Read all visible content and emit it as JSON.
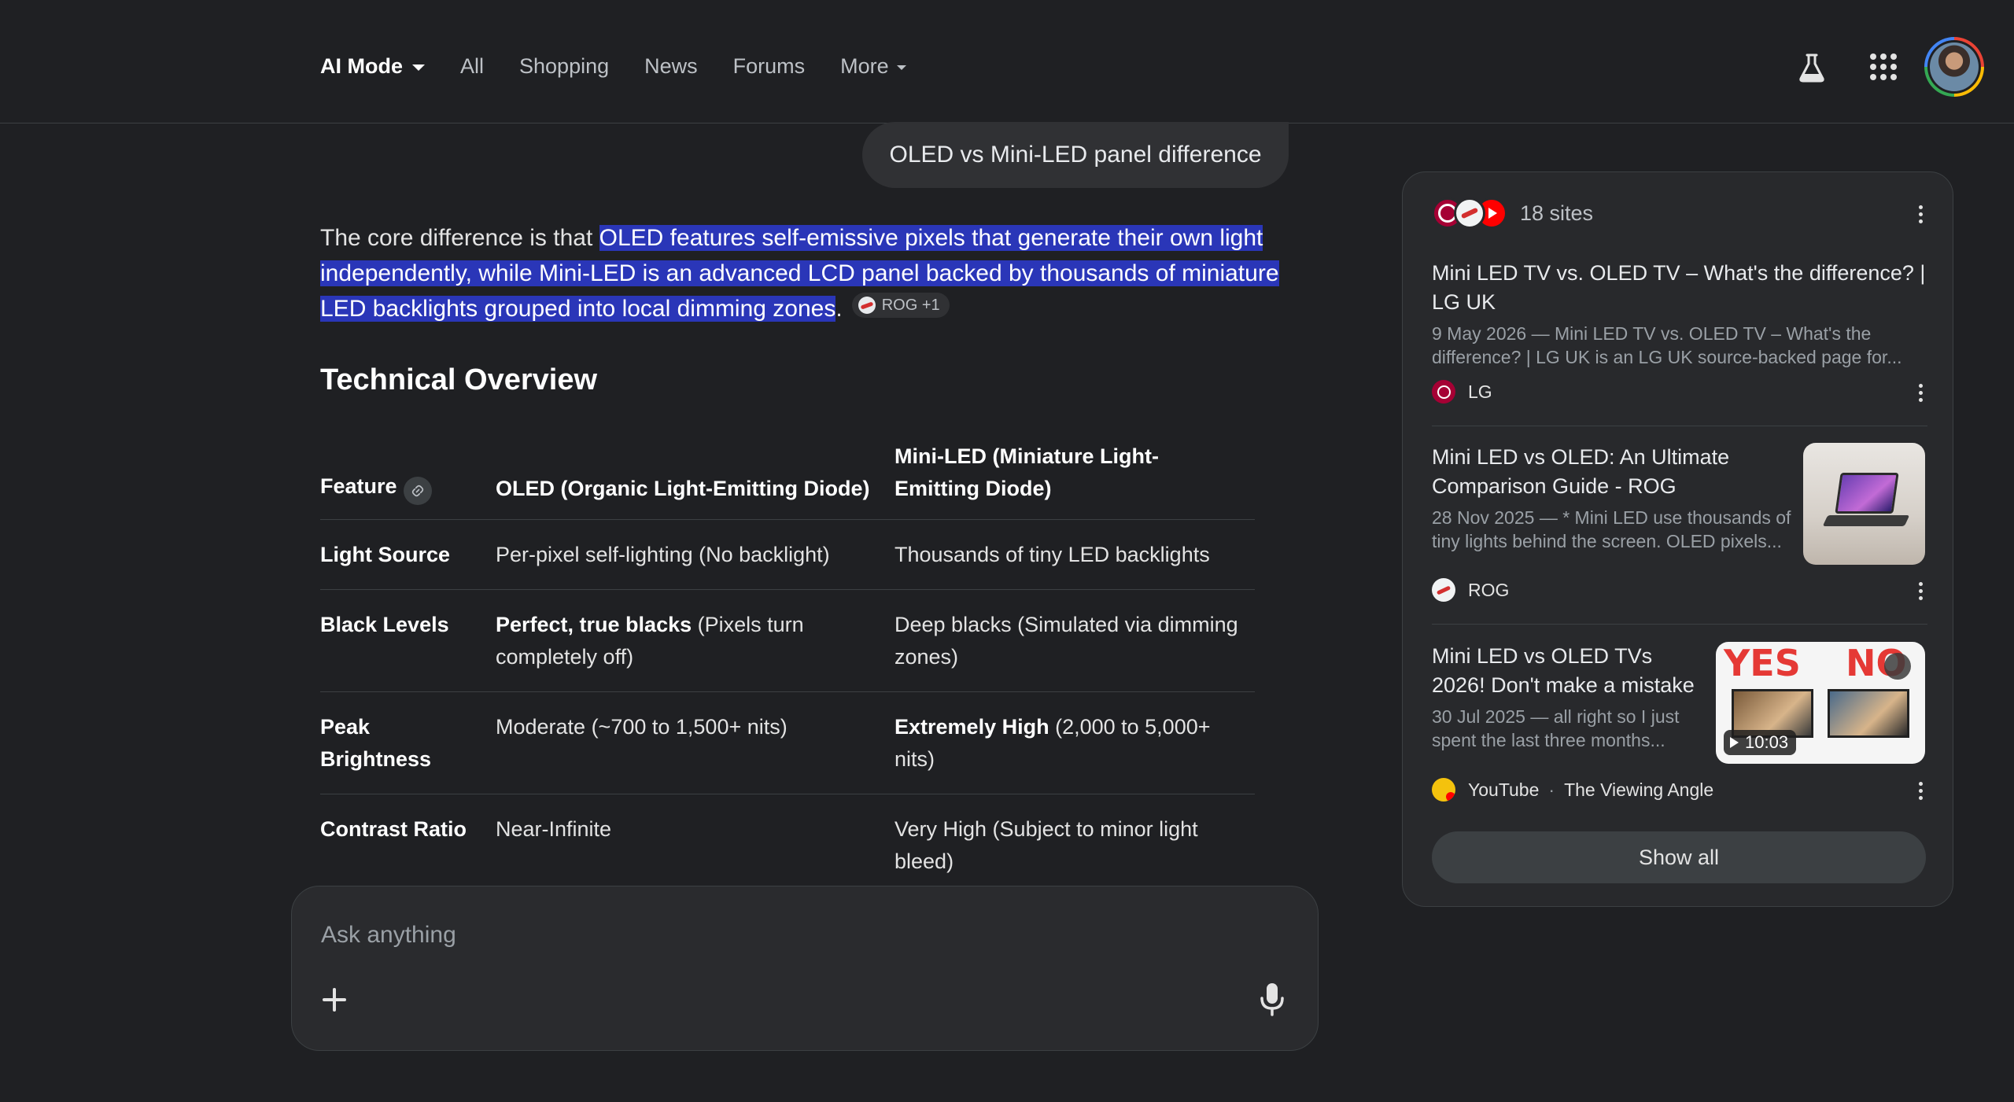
{
  "nav": {
    "ai_mode": "AI Mode",
    "all": "All",
    "shopping": "Shopping",
    "news": "News",
    "forums": "Forums",
    "more": "More"
  },
  "query": "OLED vs Mini-LED panel difference",
  "answer": {
    "intro": "The core difference is that ",
    "highlight": "OLED features self-emissive pixels that generate their own light independently, while Mini-LED is an advanced LCD panel backed by thousands of miniature LED backlights grouped into local dimming zones",
    "end": ".",
    "source_chip": "ROG +1"
  },
  "section_title": "Technical Overview",
  "table": {
    "headers": [
      "Feature",
      "OLED (Organic Light-Emitting Diode)",
      "Mini-LED (Miniature Light-Emitting Diode)"
    ],
    "rows": [
      {
        "feature": "Light Source",
        "oled_bold": "",
        "oled": "Per-pixel self-lighting (No backlight)",
        "mini_bold": "",
        "mini": "Thousands of tiny LED backlights"
      },
      {
        "feature": "Black Levels",
        "oled_bold": "Perfect, true blacks",
        "oled": " (Pixels turn completely off)",
        "mini_bold": "",
        "mini": "Deep blacks (Simulated via dimming zones)"
      },
      {
        "feature": "Peak Brightness",
        "oled_bold": "",
        "oled": "Moderate (~700 to 1,500+ nits)",
        "mini_bold": "Extremely High",
        "mini": " (2,000 to 5,000+ nits)"
      },
      {
        "feature": "Contrast Ratio",
        "oled_bold": "",
        "oled": "Near-Infinite",
        "mini_bold": "",
        "mini": "Very High (Subject to minor light bleed)"
      }
    ]
  },
  "ask": {
    "placeholder": "Ask anything"
  },
  "sources": {
    "count_label": "18 sites",
    "items": [
      {
        "title": "Mini LED TV vs. OLED TV – What's the difference? | LG UK",
        "snippet": "9 May 2026 — Mini LED TV vs. OLED TV – What's the difference? | LG UK is an LG UK source-backed page for...",
        "site": "LG",
        "channel": ""
      },
      {
        "title": "Mini LED vs OLED: An Ultimate Comparison Guide - ROG",
        "snippet": "28 Nov 2025 — * Mini LED use thousands of tiny lights behind the screen. OLED pixels...",
        "site": "ROG",
        "channel": ""
      },
      {
        "title": "Mini LED vs OLED TVs 2026! Don't make a mistake",
        "snippet": "30 Jul 2025 — all right so I just spent the last three months...",
        "site": "YouTube",
        "channel": "The Viewing Angle",
        "thumb_left": "YES",
        "thumb_right": "NO",
        "duration": "10:03"
      }
    ],
    "show_all": "Show all"
  }
}
